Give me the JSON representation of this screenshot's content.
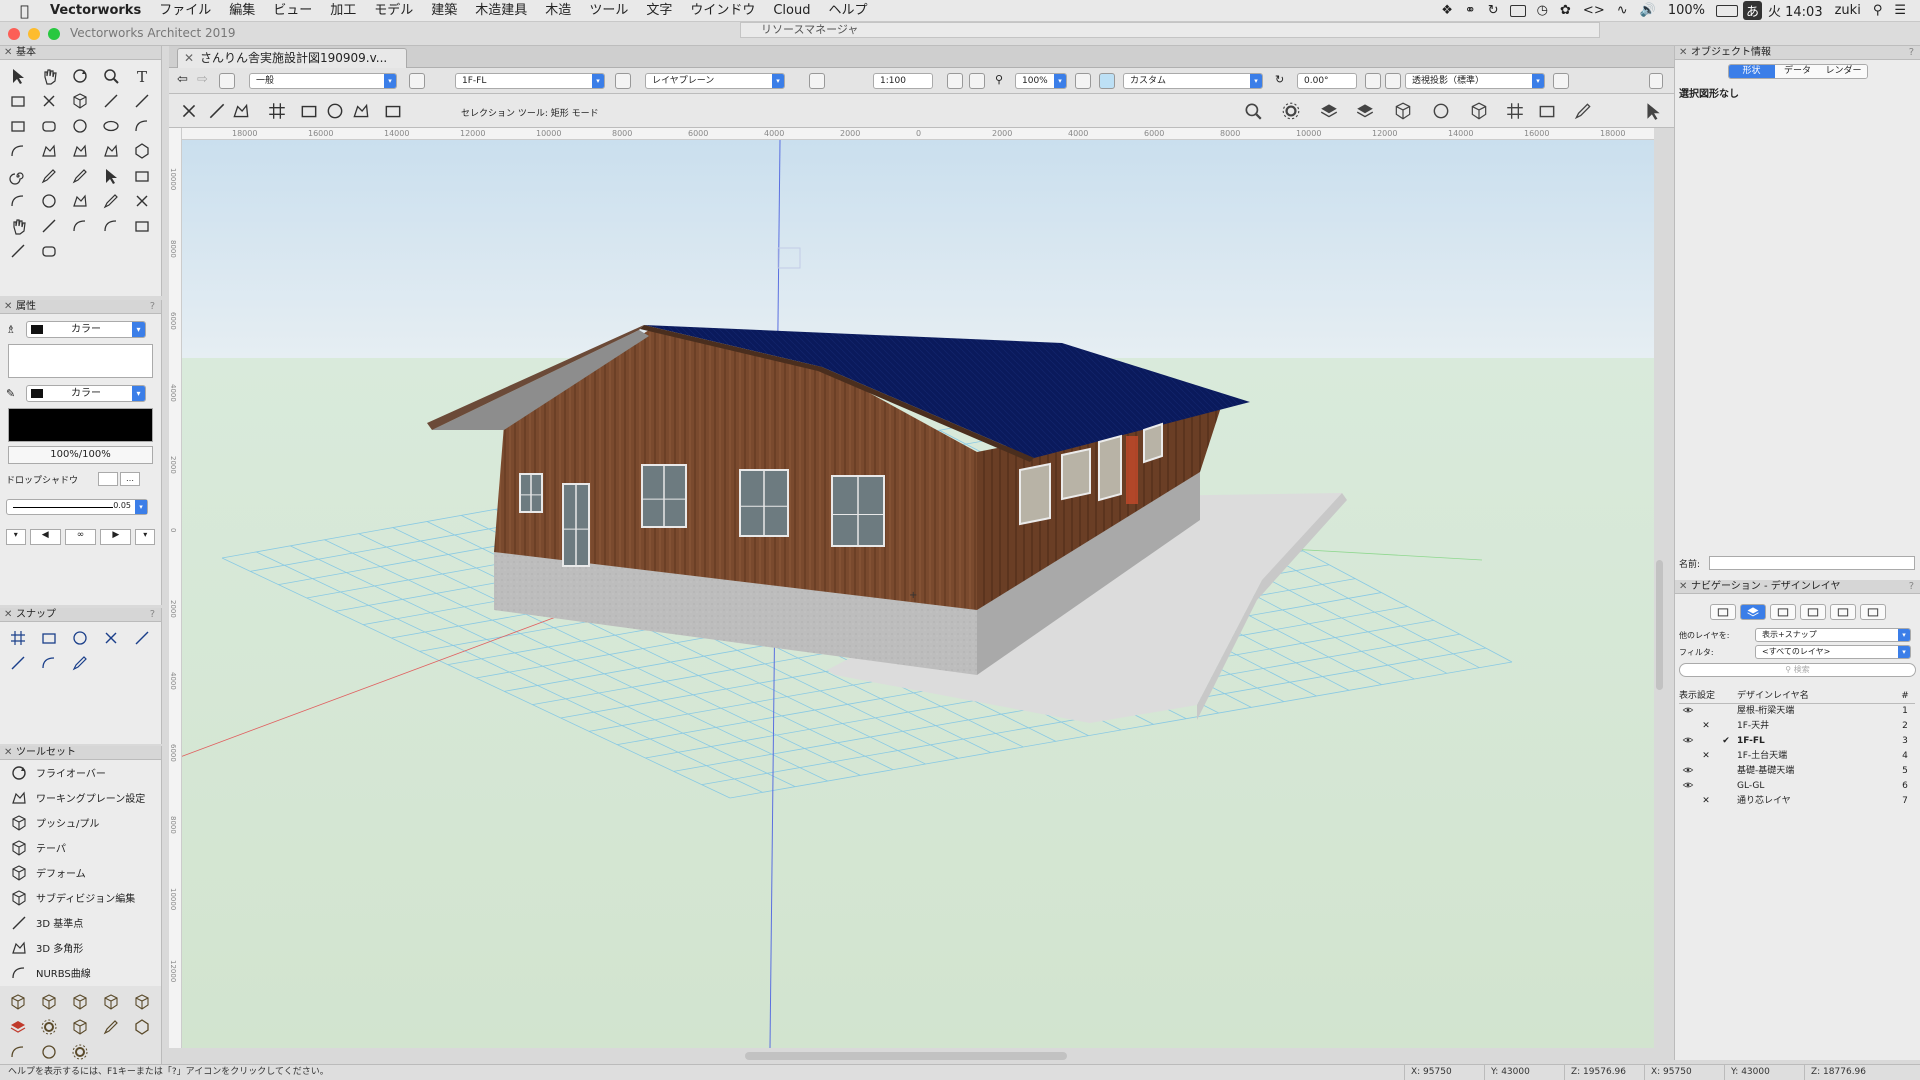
{
  "menubar": {
    "app": "Vectorworks",
    "items": [
      "ファイル",
      "編集",
      "ビュー",
      "加工",
      "モデル",
      "建築",
      "木造建具",
      "木造",
      "ツール",
      "文字",
      "ウインドウ",
      "Cloud",
      "ヘルプ"
    ],
    "battery": "100%",
    "ime": "あ",
    "clock": "火 14:03",
    "user": "zuki"
  },
  "window": {
    "title": "Vectorworks Architect 2019"
  },
  "resource_manager": {
    "title": "リソースマネージャ"
  },
  "doc_tab": {
    "label": "さんりん舎実施設計図190909.v..."
  },
  "viewbar": {
    "class": "一般",
    "layer": "1F-FL",
    "plane": "レイヤプレーン",
    "scale": "1:100",
    "zoom": "100%",
    "view": "カスタム",
    "angle": "0.00°",
    "projection": "透視投影（標準）"
  },
  "modebar": {
    "hint": "セレクション ツール: 矩形 モード"
  },
  "ruler": {
    "labels": [
      "18000",
      "16000",
      "14000",
      "12000",
      "10000",
      "8000",
      "6000",
      "4000",
      "2000",
      "0",
      "2000",
      "4000",
      "6000",
      "8000",
      "10000",
      "12000",
      "14000",
      "16000",
      "18000"
    ],
    "vlabels": [
      "10000",
      "8000",
      "6000",
      "4000",
      "2000",
      "0",
      "2000",
      "4000",
      "6000",
      "8000",
      "10000",
      "12000"
    ]
  },
  "palettes": {
    "basic": {
      "title": "基本"
    },
    "attributes": {
      "title": "属性",
      "fill_label": "カラー",
      "pen_label": "カラー",
      "opacity": "100%/100%",
      "dropshadow": "ドロップシャドウ",
      "lineweight": "0.05"
    },
    "snap": {
      "title": "スナップ"
    },
    "toolset": {
      "title": "ツールセット",
      "items": [
        "フライオーバー",
        "ワーキングプレーン設定",
        "プッシュ/プル",
        "テーパ",
        "デフォーム",
        "サブディビジョン編集",
        "3D 基準点",
        "3D 多角形",
        "NURBS曲線"
      ]
    }
  },
  "oip": {
    "title": "オブジェクト情報",
    "tabs": [
      "形状",
      "データ",
      "レンダー"
    ],
    "status": "選択図形なし",
    "name_label": "名前:"
  },
  "nav": {
    "title": "ナビゲーション - デザインレイヤ",
    "other_layers_label": "他のレイヤを:",
    "other_layers_value": "表示+スナップ",
    "filter_label": "フィルタ:",
    "filter_value": "<すべてのレイヤ>",
    "search_placeholder": "検索",
    "col_visibility": "表示設定",
    "col_name": "デザインレイヤ名",
    "col_num": "#",
    "layers": [
      {
        "vis": "eye",
        "active": "",
        "name": "屋根-桁梁天端",
        "num": "1"
      },
      {
        "vis": "x",
        "active": "",
        "name": "1F-天井",
        "num": "2"
      },
      {
        "vis": "eye",
        "active": "✔",
        "name": "1F-FL",
        "num": "3"
      },
      {
        "vis": "x",
        "active": "",
        "name": "1F-土台天端",
        "num": "4"
      },
      {
        "vis": "eye",
        "active": "",
        "name": "基礎-基礎天端",
        "num": "5"
      },
      {
        "vis": "eye",
        "active": "",
        "name": "GL-GL",
        "num": "6"
      },
      {
        "vis": "x",
        "active": "",
        "name": "通り芯レイヤ",
        "num": "7"
      }
    ]
  },
  "status": {
    "help": "ヘルプを表示するには、F1キーまたは「?」アイコンをクリックしてください。",
    "x1": "X: 95750",
    "y1": "Y: 43000",
    "z1": "Z: 19576.96",
    "x2": "X: 95750",
    "y2": "Y: 43000",
    "z2": "Z: 18776.96"
  },
  "colors": {
    "roof": "#0a1a5c",
    "wall": "#7a4a2e",
    "foundation": "#b8b8b8",
    "sky": "#cfe1ee",
    "ground": "#d4e6cf",
    "grid": "#7cc4e6",
    "accent": "#3b7ee8"
  }
}
